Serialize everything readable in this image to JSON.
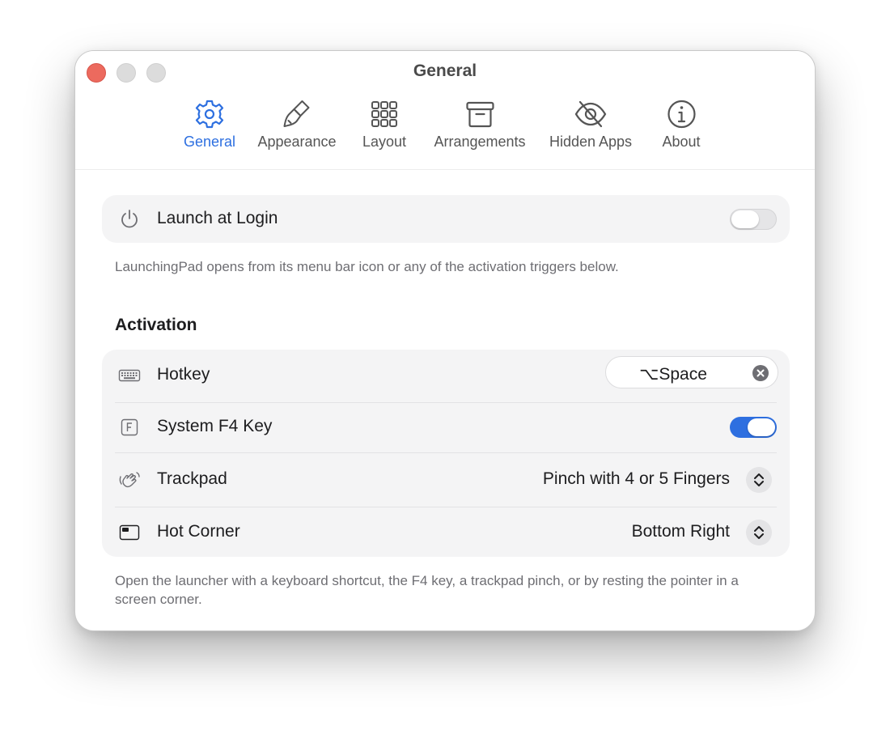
{
  "window": {
    "title": "General"
  },
  "tabs": [
    {
      "label": "General",
      "icon": "gear-icon",
      "active": true
    },
    {
      "label": "Appearance",
      "icon": "paintbrush-icon",
      "active": false
    },
    {
      "label": "Layout",
      "icon": "grid-icon",
      "active": false
    },
    {
      "label": "Arrangements",
      "icon": "archive-box-icon",
      "active": false
    },
    {
      "label": "Hidden Apps",
      "icon": "eye-slash-icon",
      "active": false
    },
    {
      "label": "About",
      "icon": "info-icon",
      "active": false
    }
  ],
  "launch": {
    "label": "Launch at Login",
    "icon": "power-icon",
    "enabled": false,
    "hint": "LaunchingPad opens from its menu bar icon or any of the activation triggers below."
  },
  "activation": {
    "title": "Activation",
    "hotkey": {
      "label": "Hotkey",
      "icon": "keyboard-icon",
      "value": "⌥Space"
    },
    "f4": {
      "label": "System F4 Key",
      "icon": "f-key-icon",
      "enabled": true
    },
    "trackpad": {
      "label": "Trackpad",
      "icon": "hand-gesture-icon",
      "value": "Pinch with 4 or 5 Fingers"
    },
    "hot_corner": {
      "label": "Hot Corner",
      "icon": "screen-corner-icon",
      "value": "Bottom Right"
    },
    "hint": "Open the launcher with a keyboard shortcut, the F4 key, a trackpad pinch, or by resting the pointer in a screen corner."
  },
  "colors": {
    "accent": "#2e6fe0",
    "close": "#ec6a5e",
    "card": "#f4f4f5"
  }
}
